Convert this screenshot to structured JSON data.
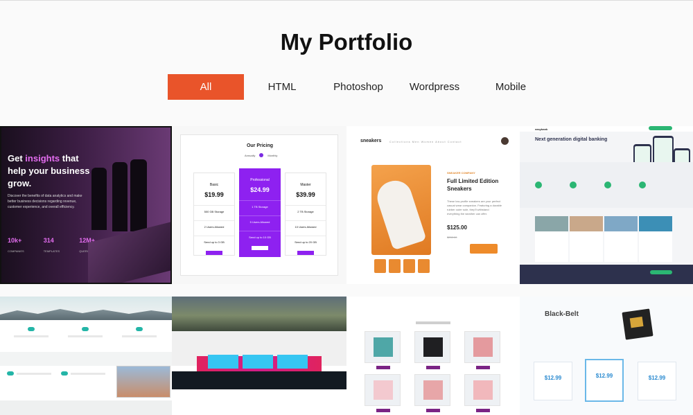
{
  "header": {
    "title_light": "My",
    "title_bold": "Portfolio"
  },
  "filters": [
    {
      "label": "All",
      "active": true
    },
    {
      "label": "HTML",
      "active": false
    },
    {
      "label": "Photoshop",
      "active": false
    },
    {
      "label": "Wordpress",
      "active": false
    },
    {
      "label": "Mobile",
      "active": false
    }
  ],
  "projects": {
    "analytics": {
      "heading_pre": "Get ",
      "heading_accent": "insights",
      "heading_post": " that help your business grow.",
      "body": "Discover the benefits of data analytics and make better business decisions regarding revenue, customer experience, and overall efficiency.",
      "stats": [
        {
          "value": "10k+",
          "label": "COMPANIES"
        },
        {
          "value": "314",
          "label": "TEMPLATES"
        },
        {
          "value": "12M+",
          "label": "QUERIES"
        }
      ]
    },
    "pricing": {
      "title": "Our Pricing",
      "toggle_left": "Annually",
      "toggle_right": "Monthly",
      "plans": [
        {
          "name": "Basic",
          "price": "$19.99",
          "storage": "500 GB Storage",
          "users": "2 Users Allowed",
          "send": "Send up to 3 GB",
          "button": "LEARN MORE"
        },
        {
          "name": "Professional",
          "price": "$24.99",
          "storage": "1 TB Storage",
          "users": "5 Users Allowed",
          "send": "Send up to 10 GB",
          "button": "LEARN MORE"
        },
        {
          "name": "Master",
          "price": "$39.99",
          "storage": "2 TB Storage",
          "users": "10 Users Allowed",
          "send": "Send up to 20 GB",
          "button": "LEARN MORE"
        }
      ]
    },
    "sneakers": {
      "brand": "sneakers",
      "nav": "Collections   Men   Women   About   Contact",
      "company": "SNEAKER COMPANY",
      "product": "Full Limited Edition Sneakers",
      "description": "These low-profile sneakers are your perfect casual wear companion. Featuring a durable rubber outer sole, they'll withstand everything the weather can offer.",
      "price": "$125.00",
      "discount": "50%",
      "old_price": "$250.00",
      "qty": "0",
      "cart": "Add to cart"
    },
    "banking": {
      "logo": "easybank",
      "heading": "Next generation digital banking"
    },
    "pricing2": {
      "heading": "Black-Belt",
      "price": "$12.99"
    }
  }
}
